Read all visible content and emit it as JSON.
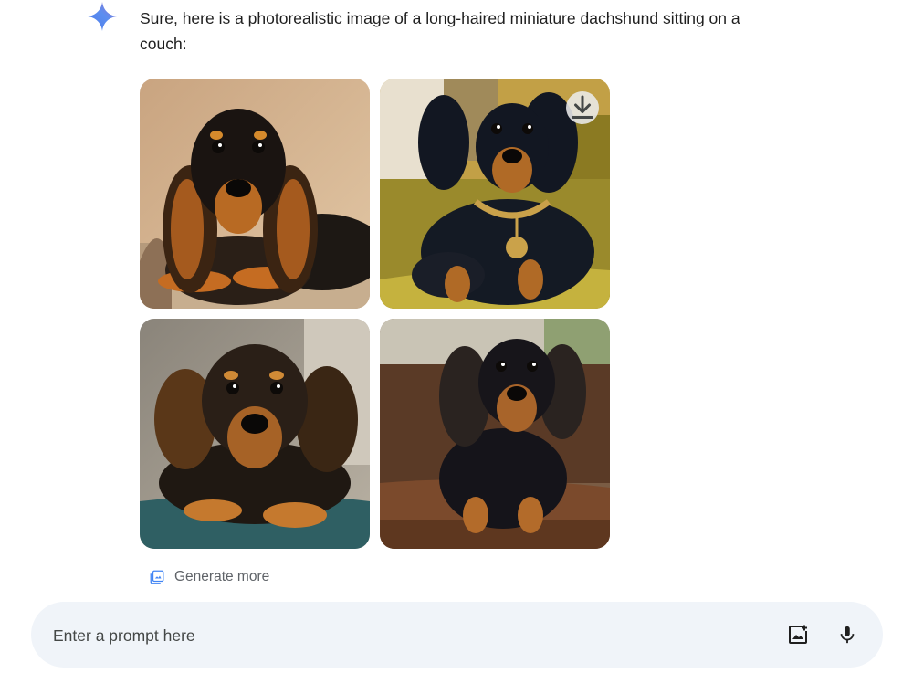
{
  "response": {
    "icon": "gemini-sparkle-icon",
    "text": "Sure, here is a photorealistic image of a long-haired miniature dachshund sitting on a couch:"
  },
  "images": [
    {
      "icon": "dachshund-image",
      "index": 1
    },
    {
      "icon": "dachshund-image",
      "index": 2,
      "overlay_icon": "download-icon"
    },
    {
      "icon": "dachshund-image",
      "index": 3
    },
    {
      "icon": "dachshund-image",
      "index": 4
    }
  ],
  "generate_more": {
    "label": "Generate more",
    "icon": "image-stack-icon"
  },
  "prompt": {
    "placeholder": "Enter a prompt here",
    "value": "",
    "upload_icon": "add-image-icon",
    "mic_icon": "microphone-icon"
  },
  "colors": {
    "accent_blue": "#4285f4",
    "prompt_bar_bg": "#f0f4f9",
    "muted_text": "#5f6368"
  }
}
